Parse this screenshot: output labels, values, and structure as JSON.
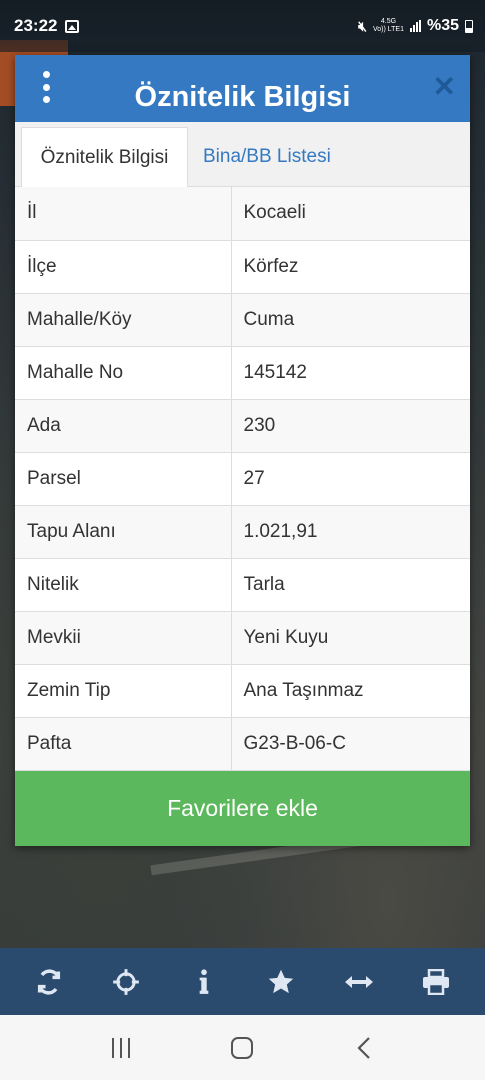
{
  "status_bar": {
    "time": "23:22",
    "network": "Vo)) LTE1",
    "network_gen": "4.5G",
    "battery": "%35"
  },
  "dialog": {
    "title": "Öznitelik Bilgisi",
    "tabs": [
      {
        "label": "Öznitelik Bilgisi",
        "active": true
      },
      {
        "label": "Bina/BB Listesi",
        "active": false
      }
    ],
    "rows": [
      {
        "key": "İl",
        "value": "Kocaeli"
      },
      {
        "key": "İlçe",
        "value": "Körfez"
      },
      {
        "key": "Mahalle/Köy",
        "value": "Cuma"
      },
      {
        "key": "Mahalle No",
        "value": "145142"
      },
      {
        "key": "Ada",
        "value": "230"
      },
      {
        "key": "Parsel",
        "value": "27"
      },
      {
        "key": "Tapu Alanı",
        "value": "1.021,91"
      },
      {
        "key": "Nitelik",
        "value": "Tarla"
      },
      {
        "key": "Mevkii",
        "value": "Yeni Kuyu"
      },
      {
        "key": "Zemin Tip",
        "value": "Ana Taşınmaz"
      },
      {
        "key": "Pafta",
        "value": "G23-B-06-C"
      }
    ],
    "favorite_button": "Favorilere ekle"
  },
  "toolbar": {
    "icons": [
      "refresh-icon",
      "crosshair-icon",
      "info-icon",
      "star-icon",
      "horizontal-arrows-icon",
      "print-icon"
    ]
  },
  "colors": {
    "header": "#3479c1",
    "button": "#5cb85c",
    "toolbar": "#2a4a6e"
  }
}
